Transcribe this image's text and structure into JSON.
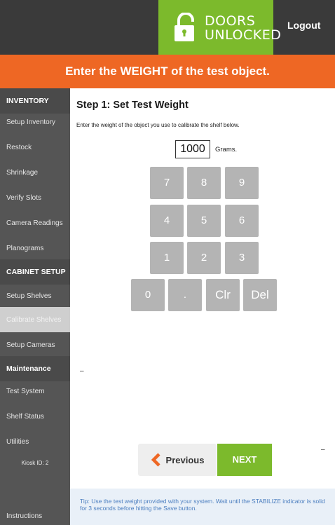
{
  "header": {
    "logo_line1": "DOORS",
    "logo_line2": "UNLOCKED",
    "logout": "Logout"
  },
  "banner": {
    "text": "Enter the WEIGHT of the test object."
  },
  "sidebar": {
    "items": [
      {
        "label": "INVENTORY",
        "section": true
      },
      {
        "label": "Setup Inventory"
      },
      {
        "label": "Restock"
      },
      {
        "label": "Shrinkage"
      },
      {
        "label": "Verify Slots"
      },
      {
        "label": "Camera Readings"
      },
      {
        "label": "Planograms"
      },
      {
        "label": "CABINET SETUP",
        "section": true
      },
      {
        "label": "Setup Shelves"
      },
      {
        "label": "Calibrate Shelves",
        "active": true
      },
      {
        "label": "Setup Cameras"
      },
      {
        "label": "Maintenance",
        "section": true
      },
      {
        "label": "Test System"
      },
      {
        "label": "Shelf Status"
      },
      {
        "label": "Utilities"
      }
    ],
    "kiosk_id": "Kiosk ID: 2",
    "instructions": "Instructions"
  },
  "main": {
    "step_title": "Step 1: Set Test Weight",
    "instructions": "Enter the weight of the object you use to calibrate the shelf below.",
    "weight_value": "1000",
    "weight_unit": "Grams.",
    "keypad": {
      "k7": "7",
      "k8": "8",
      "k9": "9",
      "k4": "4",
      "k5": "5",
      "k6": "6",
      "k1": "1",
      "k2": "2",
      "k3": "3",
      "k0": "0",
      "dot": ".",
      "clr": "Clr",
      "del": "Del"
    },
    "dash": "–",
    "previous": "Previous",
    "next": "NEXT",
    "tip": "Tip: Use the test weight provided with your system. Wait until the STABILIZE indicator is solid for 3 seconds before hitting the Save button."
  },
  "colors": {
    "header_bg": "#3a3a3a",
    "brand_green": "#7cba2c",
    "banner_orange": "#ee6724",
    "sidebar_bg": "#555555",
    "key_gray": "#b4b4b4",
    "tip_blue": "#4a7dbf"
  },
  "icons": {
    "logo": "lock-icon",
    "previous": "chevron-left-icon"
  }
}
